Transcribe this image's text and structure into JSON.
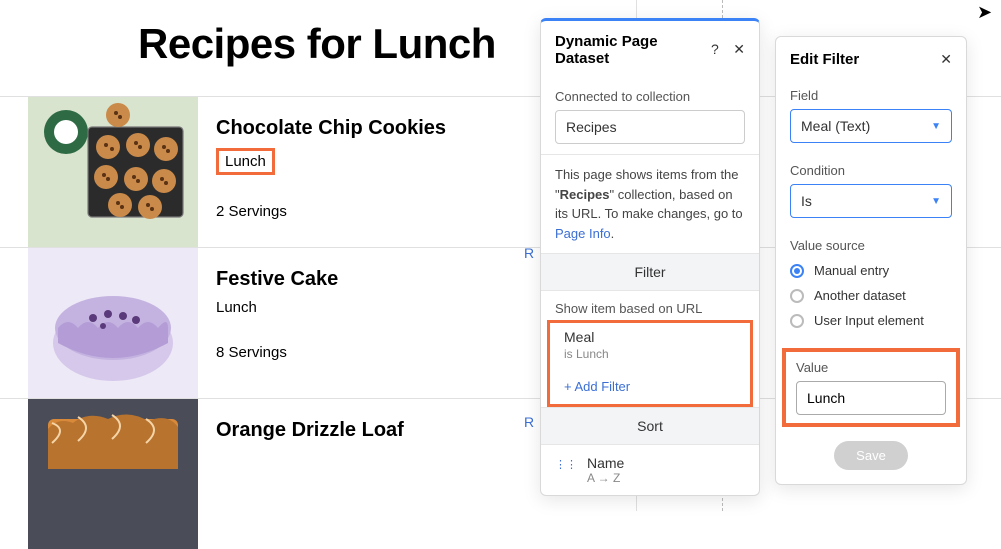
{
  "page": {
    "title": "Recipes for Lunch"
  },
  "recipes": [
    {
      "title": "Chocolate Chip Cookies",
      "meal": "Lunch",
      "servings": "2 Servings"
    },
    {
      "title": "Festive Cake",
      "meal": "Lunch",
      "servings": "8 Servings"
    },
    {
      "title": "Orange Drizzle Loaf",
      "meal": "",
      "servings": ""
    }
  ],
  "readmore": "R",
  "datasetPanel": {
    "title": "Dynamic Page Dataset",
    "connectedLabel": "Connected to collection",
    "collectionName": "Recipes",
    "desc_prefix": "This page shows items from the \"",
    "desc_bold": "Recipes",
    "desc_suffix": "\" collection, based on its URL. To make changes, go to ",
    "desc_link": "Page Info",
    "desc_dot": ".",
    "filterTitle": "Filter",
    "showItemLabel": "Show item based on URL",
    "filterField": "Meal",
    "filterCond": "is Lunch",
    "addFilter": "+ Add Filter",
    "sortTitle": "Sort",
    "sortField": "Name",
    "sortOrder": "A → Z"
  },
  "editPanel": {
    "title": "Edit Filter",
    "fieldLabel": "Field",
    "fieldValue": "Meal (Text)",
    "conditionLabel": "Condition",
    "conditionValue": "Is",
    "valueSourceLabel": "Value source",
    "opts": {
      "manual": "Manual entry",
      "another": "Another dataset",
      "user": "User Input element"
    },
    "valueLabel": "Value",
    "valueValue": "Lunch",
    "saveLabel": "Save"
  }
}
